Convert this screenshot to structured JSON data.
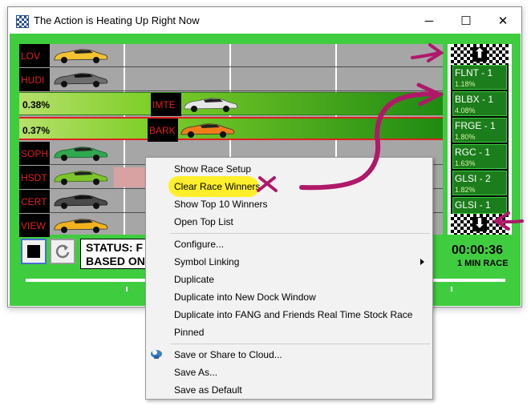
{
  "window": {
    "title": "The Action is Heating Up Right Now",
    "buttons": {
      "minimize": "─",
      "maximize": "☐",
      "close": "✕"
    }
  },
  "lanes": [
    {
      "symbol": "LOV",
      "car_color": "#f2c230"
    },
    {
      "symbol": "HUDI",
      "car_color": "#6e6e6e"
    },
    {
      "pct": "0.38%",
      "symbol": "IMTE",
      "car_color": "#e6e6e6"
    },
    {
      "pct": "0.37%",
      "symbol": "BARK",
      "car_color": "#f07d1a"
    },
    {
      "symbol": "SOPH",
      "car_color": "#2fa84f"
    },
    {
      "symbol": "HSDT",
      "car_color": "#7bc52a"
    },
    {
      "symbol": "CERT",
      "car_color": "#4a4a4a"
    },
    {
      "symbol": "VIEW",
      "car_color": "#f2b21e"
    }
  ],
  "status": {
    "line1": "STATUS: F",
    "line2": "BASED ON"
  },
  "leaderboard": [
    {
      "name": "FLNT - 1",
      "pct": "1.18%"
    },
    {
      "name": "BLBX - 1",
      "pct": "4.08%"
    },
    {
      "name": "FRGE - 1",
      "pct": "1.80%"
    },
    {
      "name": "RGC - 1",
      "pct": "1.63%"
    },
    {
      "name": "GLSI - 2",
      "pct": "1.82%"
    },
    {
      "name": "GLSI - 1",
      "pct": ""
    }
  ],
  "leaderboard_arrows": {
    "up": "⬆",
    "down": "⬇"
  },
  "timer": "00:00:36",
  "race_length": "1 MIN RACE",
  "context_menu": {
    "items": [
      "Show Race Setup",
      "Clear Race Winners",
      "Show Top 10 Winners",
      "Open Top List",
      "Configure...",
      "Symbol Linking",
      "Duplicate",
      "Duplicate into New Dock Window",
      "Duplicate into FANG and Friends Real Time Stock Race",
      "Pinned",
      "Save or Share to Cloud...",
      "Save As...",
      "Save as Default"
    ]
  },
  "colors": {
    "window_bg": "#3fcd3f",
    "track": "#a6a6a6",
    "label_text": "#e02020",
    "leader_item": "#1b7d1b",
    "highlight": "#ffef2a",
    "annotation": "#b0186a"
  }
}
